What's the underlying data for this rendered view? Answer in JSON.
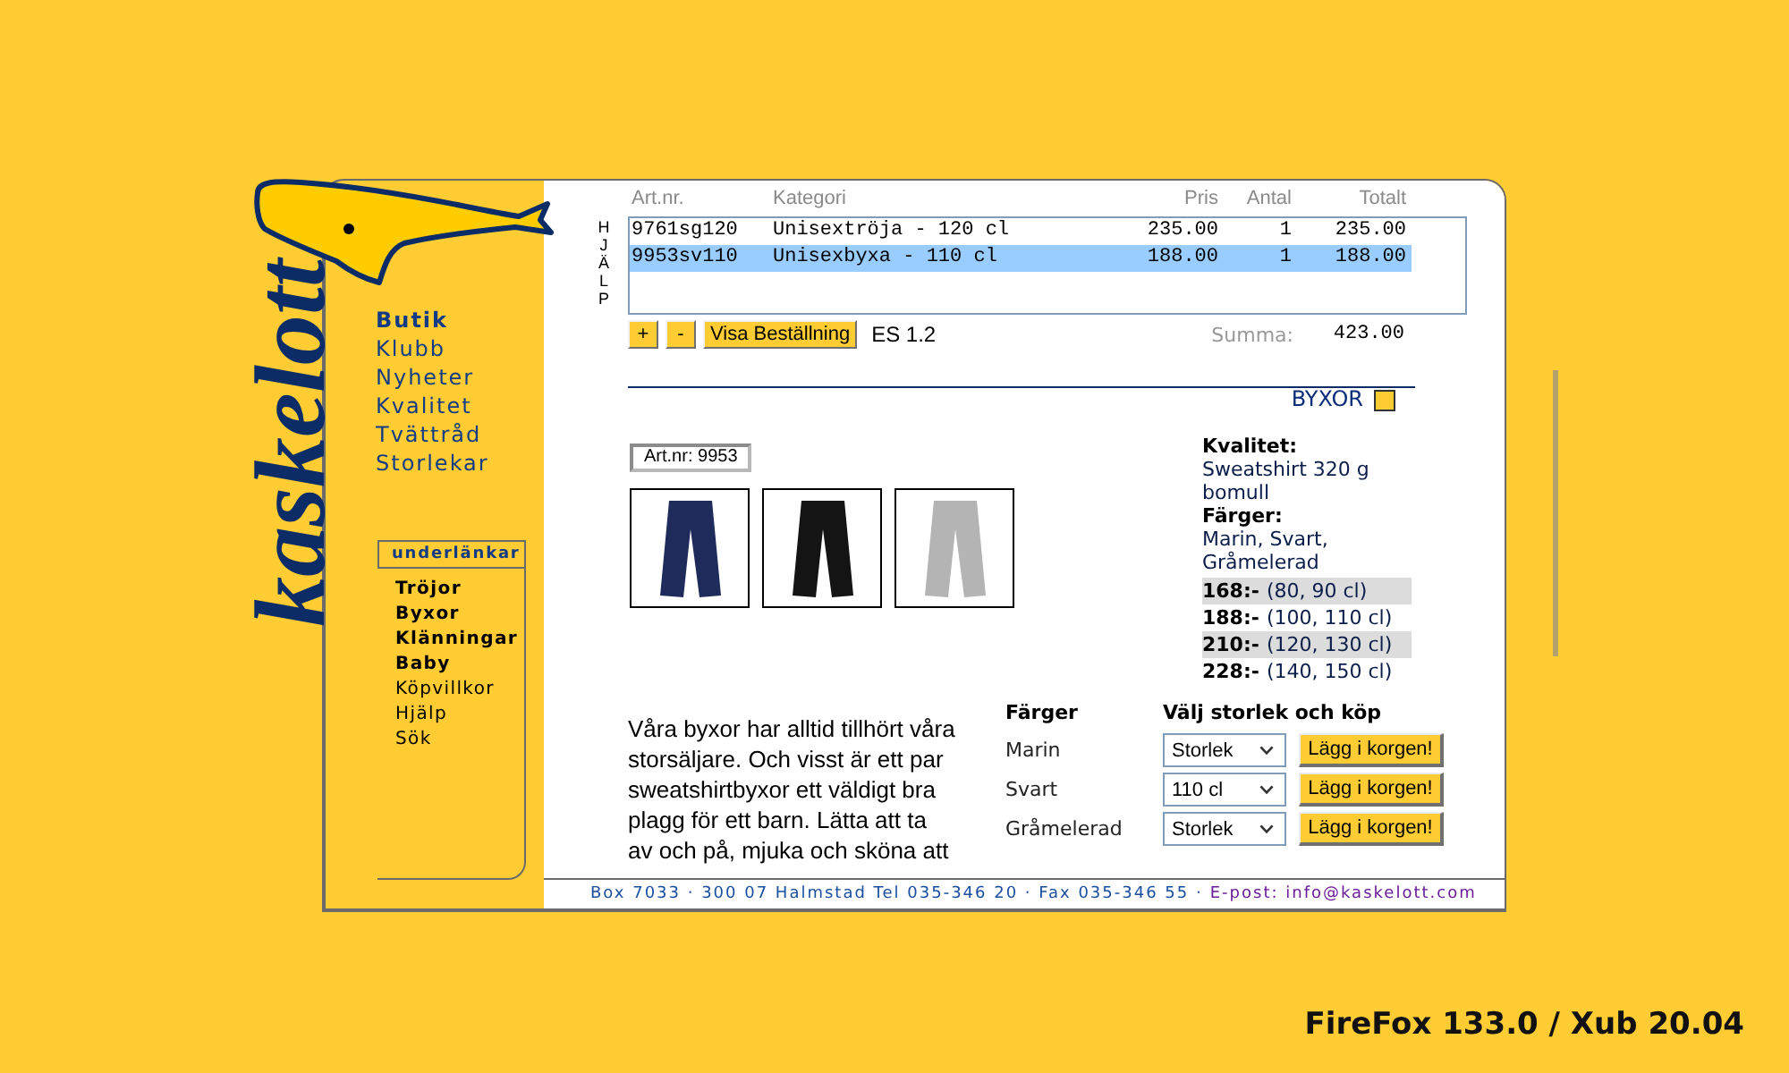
{
  "logo": {
    "text": "kaskelott"
  },
  "nav": {
    "items": [
      {
        "label": "Butik",
        "selected": true
      },
      {
        "label": "Klubb",
        "selected": false
      },
      {
        "label": "Nyheter",
        "selected": false
      },
      {
        "label": "Kvalitet",
        "selected": false
      },
      {
        "label": "Tvättråd",
        "selected": false
      },
      {
        "label": "Storlekar",
        "selected": false
      }
    ]
  },
  "sublinks": {
    "heading": "underlänkar",
    "items": [
      {
        "label": "Tröjor",
        "kind": "category"
      },
      {
        "label": "Byxor",
        "kind": "category"
      },
      {
        "label": "Klänningar",
        "kind": "category"
      },
      {
        "label": "Baby",
        "kind": "category"
      },
      {
        "label": "Köpvillkor",
        "kind": "page"
      },
      {
        "label": "Hjälp",
        "kind": "page"
      },
      {
        "label": "Sök",
        "kind": "page"
      }
    ]
  },
  "cart": {
    "help_label": "HJÄLP",
    "columns": [
      "Art.nr.",
      "Kategori",
      "Pris",
      "Antal",
      "Totalt"
    ],
    "rows": [
      {
        "art_nr": "9761sg120",
        "category": "Unisextröja - 120 cl",
        "price": "235.00",
        "quantity": "1",
        "total": "235.00",
        "selected": false
      },
      {
        "art_nr": "9953sv110",
        "category": "Unisexbyxa - 110 cl",
        "price": "188.00",
        "quantity": "1",
        "total": "188.00",
        "selected": true
      }
    ],
    "buttons": [
      "+",
      "-",
      "Visa Beställning"
    ],
    "version": "ES 1.2",
    "sum_label": "Summa:",
    "sum_value": "423.00"
  },
  "product": {
    "category": "BYXOR",
    "art_nr": "Art.nr: 9953",
    "photos": [
      {
        "color": "#1f2b5a"
      },
      {
        "color": "#141414"
      },
      {
        "color": "#b4b4b4"
      }
    ],
    "details": [
      {
        "label": "Kvalitet:",
        "text": "Sweatshirt 320 g bomull"
      },
      {
        "label": "Färger:",
        "text": "Marin, Svart, Gråmelerad"
      }
    ],
    "prices": [
      {
        "price": "168:-",
        "sizes": "(80, 90 cl)"
      },
      {
        "price": "188:-",
        "sizes": "(100, 110 cl)"
      },
      {
        "price": "210:-",
        "sizes": "(120, 130 cl)"
      },
      {
        "price": "228:-",
        "sizes": "(140, 150 cl)"
      }
    ],
    "description": "Våra byxor har alltid tillhört våra storsäljare. Och visst är ett par sweatshirtbyxor ett väldigt bra plagg för ett barn. Lätta att ta av och på, mjuka och sköna att",
    "order": {
      "columns": [
        "Färger",
        "Välj storlek och köp"
      ],
      "rows": [
        {
          "color_name": "Marin",
          "size": "Storlek",
          "button": "Lägg i korgen!"
        },
        {
          "color_name": "Svart",
          "size": "110 cl",
          "button": "Lägg i korgen!"
        },
        {
          "color_name": "Gråmelerad",
          "size": "Storlek",
          "button": "Lägg i korgen!"
        }
      ]
    }
  },
  "footer": {
    "address": "Box 7033 · 300 07 Halmstad Tel 035-346 20 · Fax 035-346 55 ·",
    "email": "E-post: info@kaskelott.com"
  },
  "caption": "FireFox 133.0 / Xub 20.04"
}
